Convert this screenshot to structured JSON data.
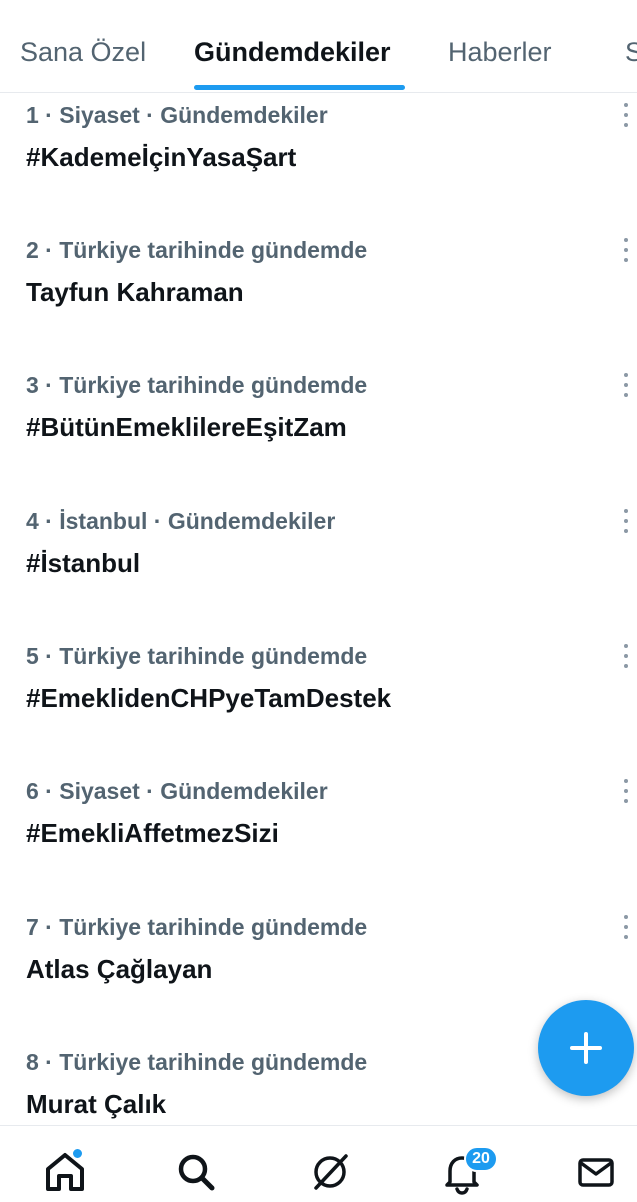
{
  "tabs": [
    {
      "label": "Sana Özel",
      "active": false
    },
    {
      "label": "Gündemdekiler",
      "active": true
    },
    {
      "label": "Haberler",
      "active": false
    },
    {
      "label": "S",
      "active": false
    }
  ],
  "trends": [
    {
      "meta": "1 · Siyaset · Gündemdekiler",
      "name": "#KademeİçinYasaŞart"
    },
    {
      "meta": "2 · Türkiye tarihinde gündemde",
      "name": "Tayfun Kahraman"
    },
    {
      "meta": "3 · Türkiye tarihinde gündemde",
      "name": "#BütünEmeklilereEşitZam"
    },
    {
      "meta": "4 · İstanbul · Gündemdekiler",
      "name": "#İstanbul"
    },
    {
      "meta": "5 · Türkiye tarihinde gündemde",
      "name": "#EmeklidenCHPyeTamDestek"
    },
    {
      "meta": "6 · Siyaset · Gündemdekiler",
      "name": "#EmekliAffetmezSizi"
    },
    {
      "meta": "7 · Türkiye tarihinde gündemde",
      "name": "Atlas Çağlayan"
    },
    {
      "meta": "8 · Türkiye tarihinde gündemde",
      "name": "Murat Çalık"
    }
  ],
  "fab": {
    "icon": "plus-icon"
  },
  "bottom_nav": {
    "items": [
      {
        "icon": "home-icon",
        "has_dot": true
      },
      {
        "icon": "search-icon"
      },
      {
        "icon": "grok-icon"
      },
      {
        "icon": "bell-icon",
        "badge": "20"
      },
      {
        "icon": "mail-icon"
      }
    ]
  },
  "colors": {
    "accent": "#1d9bf0",
    "text_primary": "#0f1419",
    "text_secondary": "#536471",
    "divider": "#e7eaee"
  }
}
